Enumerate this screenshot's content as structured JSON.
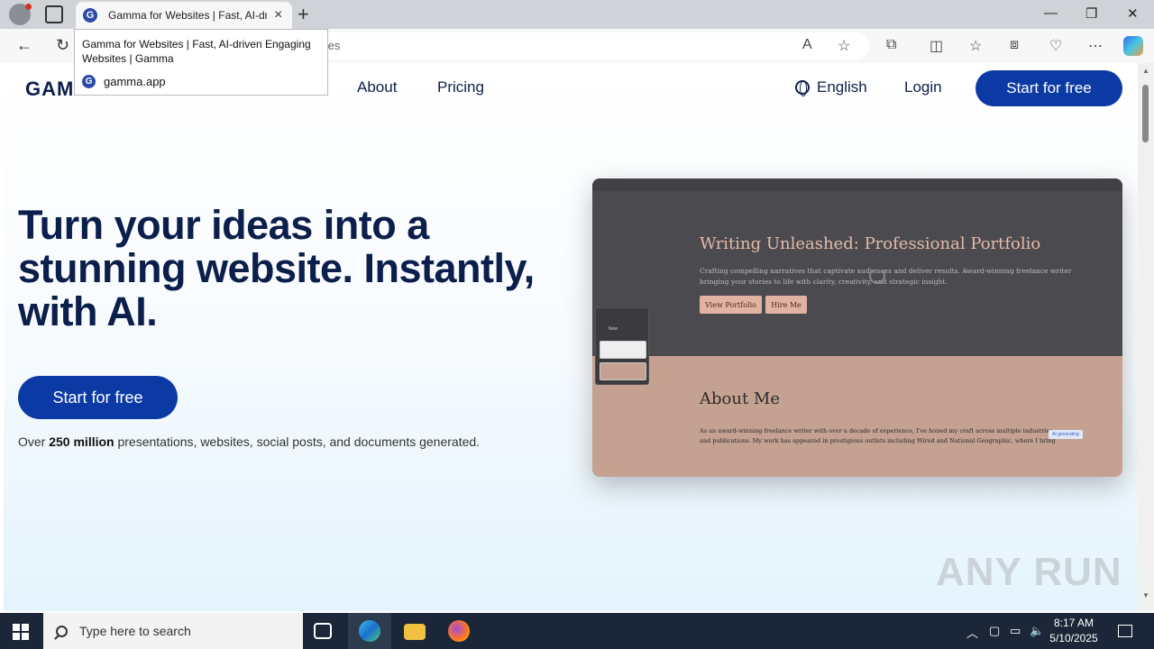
{
  "browser": {
    "tab_title": "Gamma for Websites | Fast, AI-driven Engaging Websites | Gamma",
    "tab_icon": "gamma-favicon",
    "tab_favicon_letter": "G",
    "new_tab_label": "+",
    "address_partial": "tes",
    "tooltip": {
      "title": "Gamma for Websites | Fast, AI-driven Engaging Websites | Gamma",
      "domain": "gamma.app"
    },
    "window_controls": [
      "minimize",
      "restore",
      "close"
    ],
    "toolbar_icons": [
      "read-aloud-icon",
      "favorite-star-icon",
      "extensions-icon",
      "split-screen-icon",
      "favorites-icon",
      "collections-icon",
      "performance-icon",
      "more-icon",
      "copilot-icon"
    ]
  },
  "site": {
    "logo": "GAMMA",
    "nav": {
      "about": "About",
      "pricing": "Pricing",
      "language": "English",
      "login": "Login",
      "start_top": "Start for free"
    },
    "hero": {
      "headline": "Turn your ideas into a stunning website. Instantly, with AI.",
      "cta": "Start for free",
      "stat_prefix": "Over ",
      "stat_bold": "250 million",
      "stat_suffix": " presentations, websites, social posts, and documents generated."
    },
    "preview": {
      "title": "Writing Unleashed: Professional Portfolio",
      "description": "Crafting compelling narratives that captivate audiences and deliver results. Award-winning freelance writer bringing your stories to life with clarity, creativity, and strategic insight.",
      "btn_portfolio": "View Portfolio",
      "btn_hire": "Hire Me",
      "about_heading": "About Me",
      "about_text": "As an award-winning freelance writer with over a decade of experience, I've honed my craft across multiple industries and publications. My work has appeared in prestigious outlets including Wired and National Geographic, where I bring",
      "ai_badge": "AI generating",
      "panel_new": "New",
      "colors": {
        "top": "#4b4b4f",
        "bottom": "#c4a191",
        "accent": "#e2b3a2"
      }
    }
  },
  "watermark": "ANY RUN",
  "taskbar": {
    "search_placeholder": "Type here to search",
    "time": "8:17 AM",
    "date": "5/10/2025",
    "apps": [
      "task-view-icon",
      "edge-icon",
      "file-explorer-icon",
      "firefox-icon"
    ]
  },
  "colors": {
    "brand": "#0c3aa5",
    "text_dark": "#0c1e4b",
    "taskbar": "#1b2738"
  }
}
